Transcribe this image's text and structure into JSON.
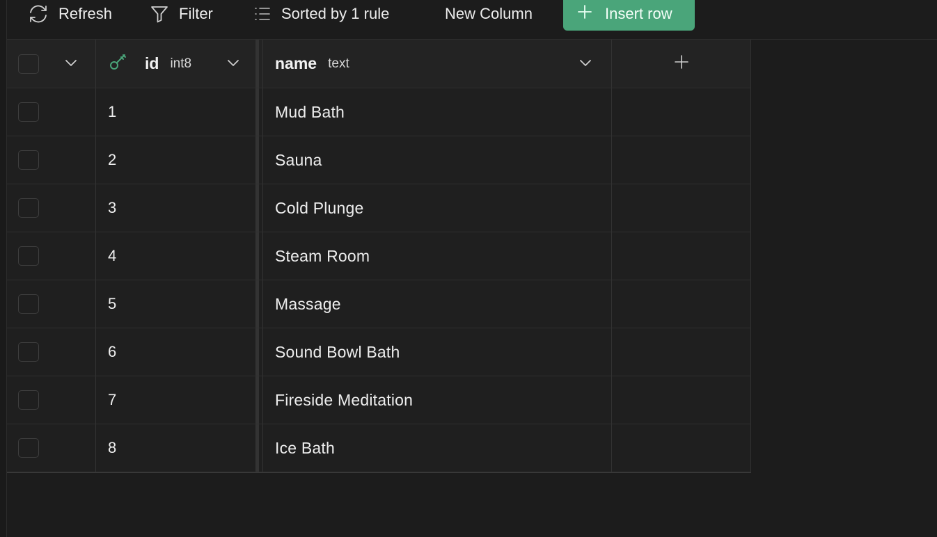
{
  "toolbar": {
    "refresh_label": "Refresh",
    "filter_label": "Filter",
    "sort_label": "Sorted by 1 rule",
    "new_column_label": "New Column",
    "insert_row_label": "Insert row",
    "accent_color": "#4aa57a"
  },
  "columns": [
    {
      "name": "id",
      "type": "int8",
      "icon": "key-icon"
    },
    {
      "name": "name",
      "type": "text"
    }
  ],
  "add_column_icon": "plus-icon",
  "rows": [
    {
      "id": "1",
      "name": "Mud Bath"
    },
    {
      "id": "2",
      "name": "Sauna"
    },
    {
      "id": "3",
      "name": "Cold Plunge"
    },
    {
      "id": "4",
      "name": "Steam Room"
    },
    {
      "id": "5",
      "name": "Massage"
    },
    {
      "id": "6",
      "name": "Sound Bowl Bath"
    },
    {
      "id": "7",
      "name": "Fireside Meditation"
    },
    {
      "id": "8",
      "name": "Ice Bath"
    }
  ]
}
